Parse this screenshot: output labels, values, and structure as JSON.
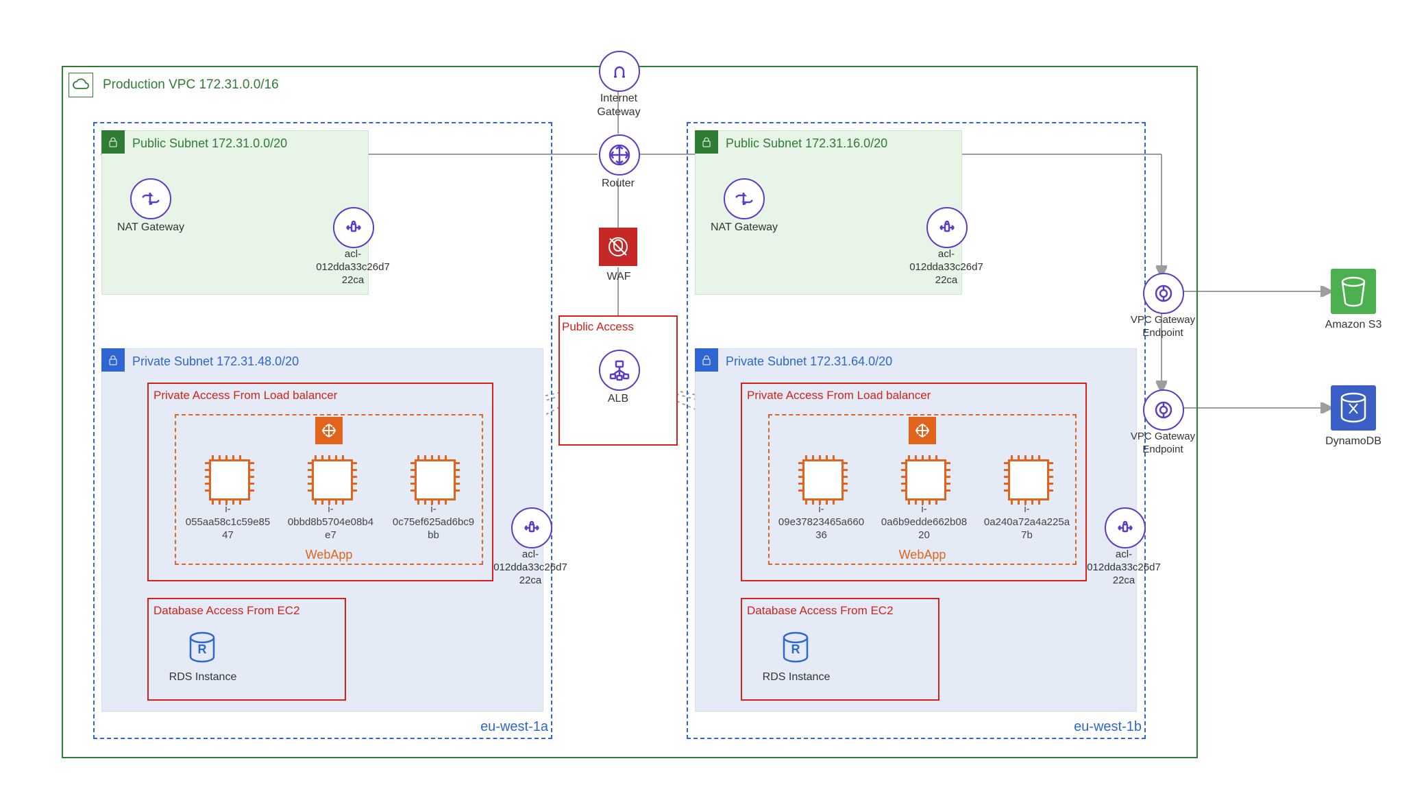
{
  "vpc": {
    "label": "Production VPC 172.31.0.0/16",
    "icon": "cloud-icon"
  },
  "center": {
    "igw": {
      "label": "Internet\nGateway",
      "icon": "horseshoe-icon"
    },
    "router": {
      "label": "Router",
      "icon": "router-cross-arrows-icon"
    },
    "waf": {
      "label": "WAF",
      "icon": "shield-bug-icon"
    },
    "public_access_sg": {
      "label": "Public Access"
    },
    "alb": {
      "label": "ALB",
      "icon": "load-balancer-icon"
    }
  },
  "az": [
    {
      "name": "eu-west-1a",
      "public_subnet": {
        "label": "Public Subnet 172.31.0.0/20",
        "nat": {
          "label": "NAT Gateway",
          "icon": "nat-gateway-icon"
        },
        "nacl": {
          "label": "acl-\n012dda33c26d7\n22ca",
          "icon": "network-acl-icon"
        }
      },
      "private_subnet": {
        "label": "Private Subnet 172.31.48.0/20",
        "nacl": {
          "label": "acl-\n012dda33c26d7\n22ca",
          "icon": "network-acl-icon"
        },
        "lb_sg": {
          "label": "Private Access From Load balancer"
        },
        "asg": {
          "label": "WebApp",
          "icon": "autoscaling-icon"
        },
        "instances": [
          {
            "id": "i-\n055aa58c1c59e85\n47"
          },
          {
            "id": "i-\n0bbd8b5704e08b4\ne7"
          },
          {
            "id": "i-\n0c75ef625ad6bc9\nbb"
          }
        ],
        "db_sg": {
          "label": "Database Access From EC2"
        },
        "rds": {
          "label": "RDS Instance",
          "icon": "rds-icon"
        }
      }
    },
    {
      "name": "eu-west-1b",
      "public_subnet": {
        "label": "Public Subnet 172.31.16.0/20",
        "nat": {
          "label": "NAT Gateway",
          "icon": "nat-gateway-icon"
        },
        "nacl": {
          "label": "acl-\n012dda33c26d7\n22ca",
          "icon": "network-acl-icon"
        }
      },
      "private_subnet": {
        "label": "Private Subnet 172.31.64.0/20",
        "nacl": {
          "label": "acl-\n012dda33c26d7\n22ca",
          "icon": "network-acl-icon"
        },
        "lb_sg": {
          "label": "Private Access From Load balancer"
        },
        "asg": {
          "label": "WebApp",
          "icon": "autoscaling-icon"
        },
        "instances": [
          {
            "id": "i-\n09e37823465a660\n36"
          },
          {
            "id": "i-\n0a6b9edde662b08\n20"
          },
          {
            "id": "i-\n0a240a72a4a225a\n7b"
          }
        ],
        "db_sg": {
          "label": "Database Access From EC2"
        },
        "rds": {
          "label": "RDS Instance",
          "icon": "rds-icon"
        }
      }
    }
  ],
  "endpoints": [
    {
      "label": "VPC Gateway\nEndpoint",
      "icon": "vpc-endpoint-icon"
    },
    {
      "label": "VPC Gateway\nEndpoint",
      "icon": "vpc-endpoint-icon"
    }
  ],
  "external": [
    {
      "label": "Amazon S3",
      "icon": "s3-bucket-icon",
      "color": "green"
    },
    {
      "label": "DynamoDB",
      "icon": "dynamodb-icon",
      "color": "blue"
    }
  ],
  "colors": {
    "vpc_border": "#2e7d32",
    "az_border": "#2f66d1",
    "sg_border": "#d1231b",
    "asg_border": "#e0641b",
    "purple_icon": "#5a3dc4",
    "waf_bg": "#c62828"
  }
}
